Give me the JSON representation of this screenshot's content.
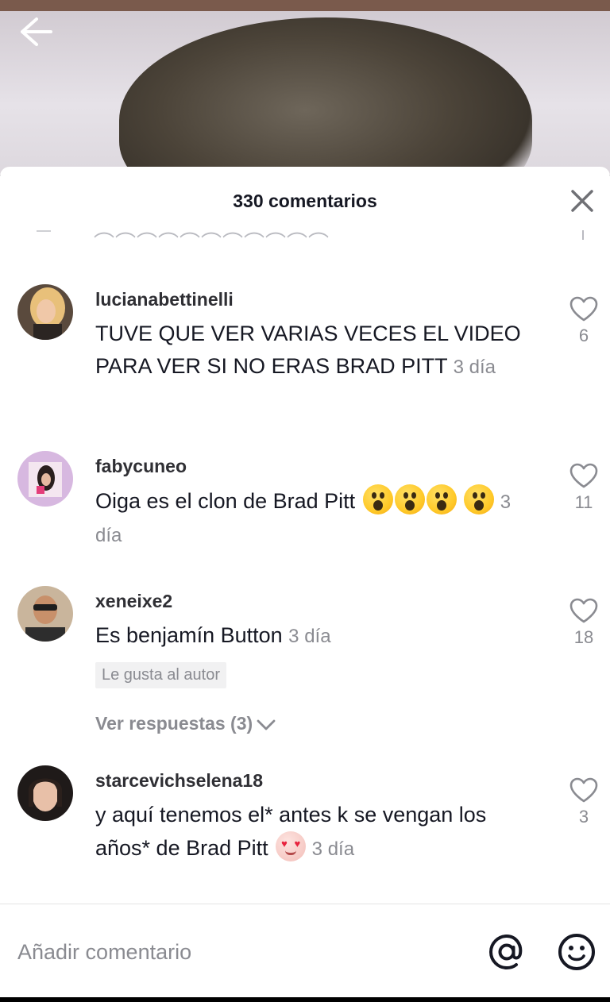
{
  "header": {
    "title": "330 comentarios"
  },
  "comments": [
    {
      "username": "lucianabettinelli",
      "text": "TUVE QUE VER VARIAS VECES EL VIDEO PARA VER SI NO ERAS BRAD PITT",
      "time": "3 día",
      "likes": "6"
    },
    {
      "username": "fabycuneo",
      "text": "Oiga es el clon de Brad Pitt",
      "time": "3 día",
      "likes": "11"
    },
    {
      "username": "xeneixe2",
      "text": "Es benjamín Button",
      "time": "3 día",
      "likes": "18",
      "badge": "Le gusta al autor",
      "replies": "Ver respuestas (3)"
    },
    {
      "username": "starcevichselena18",
      "text": "y aquí tenemos el* antes k se vengan los años* de Brad Pitt",
      "time": "3 día",
      "likes": "3"
    }
  ],
  "composer": {
    "placeholder": "Añadir comentario"
  },
  "colors": {
    "text_primary": "#161823",
    "text_secondary": "#8a8b91",
    "divider": "#e3e3e4"
  },
  "icons": [
    "back-arrow-icon",
    "close-icon",
    "heart-outline-icon",
    "chevron-down-icon",
    "at-mention-icon",
    "emoji-smiley-icon"
  ]
}
